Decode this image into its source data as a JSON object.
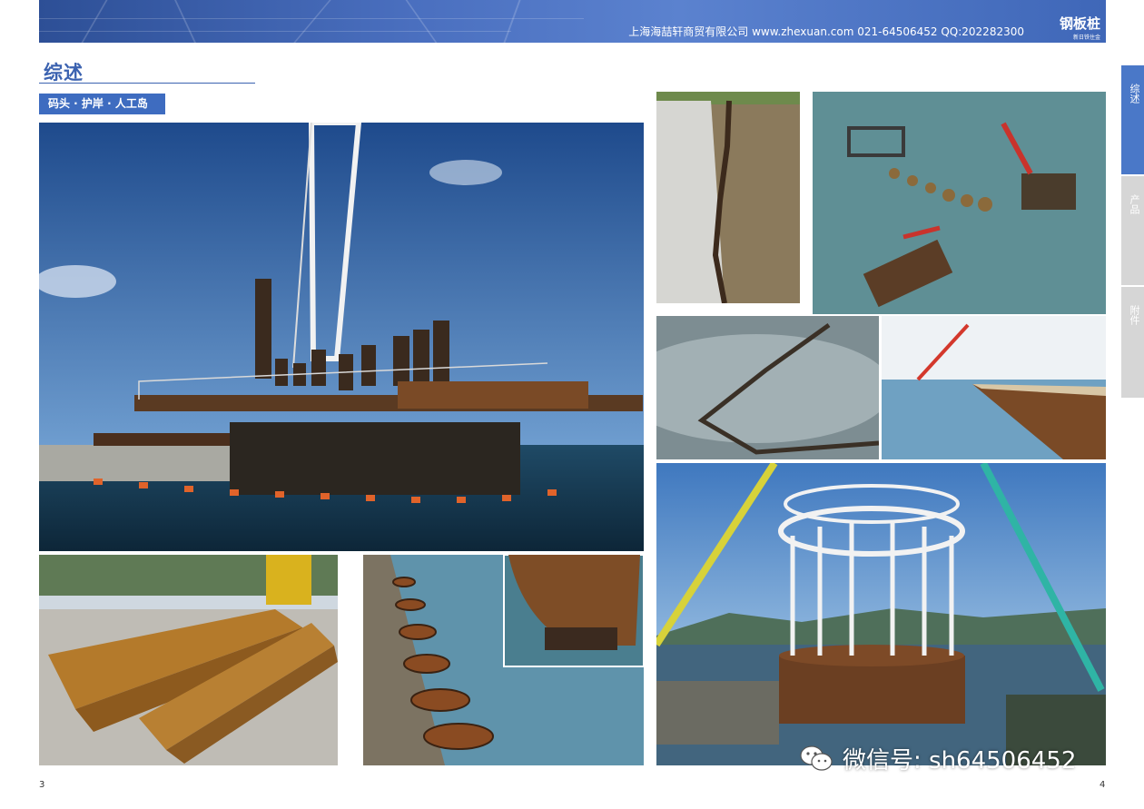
{
  "header": {
    "company_line": "上海海喆轩商贸有限公司  www.zhexuan.com 021-64506452 QQ:202282300",
    "brand": "钢板桩",
    "brand_sub": "新日铁住金"
  },
  "section": {
    "title": "综述",
    "tag": "码头 · 护岸 · 人工岛"
  },
  "side_tabs": [
    {
      "label": "综述",
      "active": true
    },
    {
      "label": "产品",
      "active": false
    },
    {
      "label": "附件",
      "active": false
    }
  ],
  "page_numbers": {
    "left": "3",
    "right": "4"
  },
  "watermark": {
    "text": "微信号: sh64506452",
    "icon": "wechat-icon"
  },
  "colors": {
    "accent": "#3e6cc0",
    "banner": "#3f67b8",
    "tab_active": "#4a78c8",
    "tab_inactive": "#d6d6d6"
  }
}
